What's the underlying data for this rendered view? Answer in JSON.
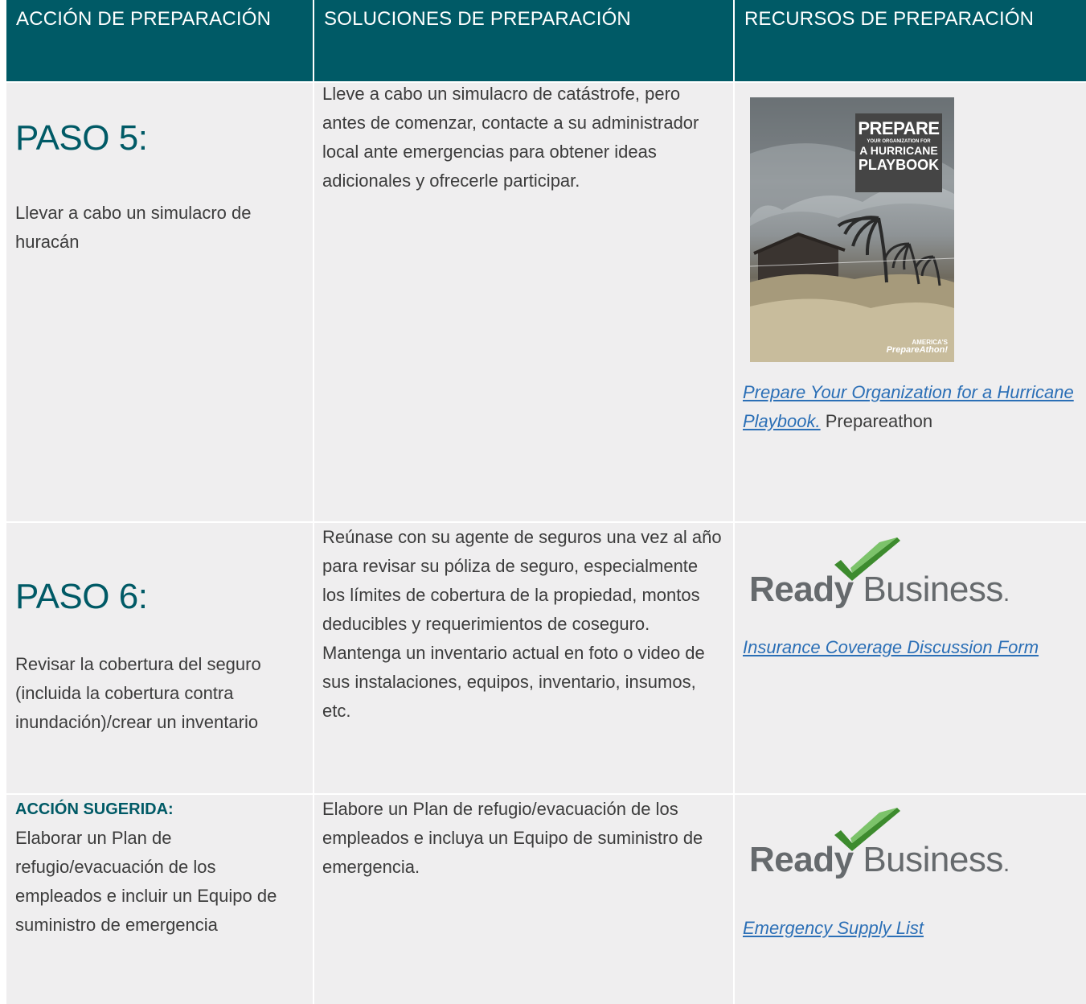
{
  "headers": {
    "col1": "ACCIÓN DE PREPARACIÓN",
    "col2": "SOLUCIONES DE PREPARACIÓN",
    "col3": "RECURSOS DE PREPARACIÓN"
  },
  "rows": [
    {
      "step_title": "PASO 5:",
      "step_desc": "Llevar a cabo un simulacro de huracán",
      "solution": "Lleve a cabo un simulacro de catástrofe, pero antes de comenzar, contacte a su administrador local ante emergencias para obtener ideas adicionales y ofrecerle participar.",
      "resource": {
        "cover": {
          "line1": "PREPARE",
          "line2": "YOUR ORGANIZATION FOR",
          "line3": "A HURRICANE",
          "line4": "PLAYBOOK",
          "logo_top": "AMERICA'S",
          "logo_main": "PrepareAthon!"
        },
        "link_text": "Prepare Your Organization for a Hurricane Playbook.",
        "source": "Prepareathon"
      }
    },
    {
      "step_title": "PASO 6:",
      "step_desc": "Revisar la cobertura del seguro (incluida la cobertura contra inundación)/crear un inventario",
      "solution": "Reúnase con su agente de seguros una vez al año para revisar su póliza de seguro, especialmente los límites de cobertura de la propiedad, montos deducibles y requerimientos de coseguro. Mantenga un inventario actual en foto o video de sus instalaciones, equipos, inventario, insumos, etc.",
      "resource": {
        "logo_bold": "Ready",
        "logo_light": "Business",
        "link_text": "Insurance Coverage Discussion Form"
      }
    },
    {
      "suggested_title": "ACCIÓN SUGERIDA:",
      "step_desc": "Elaborar un Plan de refugio/evacuación de los empleados e incluir un Equipo de suministro de emergencia",
      "solution": "Elabore un Plan de refugio/evacuación de los empleados e incluya un Equipo de suministro de emergencia.",
      "resource": {
        "logo_bold": "Ready",
        "logo_light": "Business",
        "link_text": "Emergency Supply List"
      }
    }
  ],
  "colors": {
    "header_bg": "#005a66",
    "cell_bg": "#efeeef",
    "link": "#2b6fb6",
    "check_dark": "#3d8b2e",
    "check_light": "#7cc36a"
  }
}
